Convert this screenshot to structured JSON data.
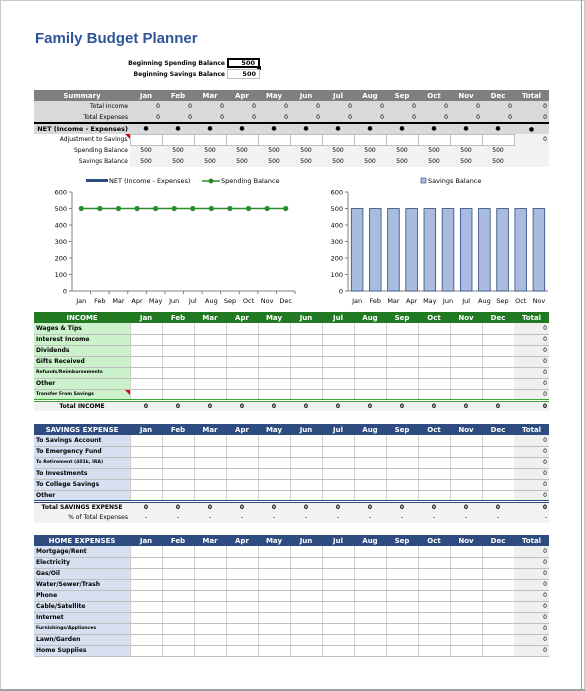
{
  "title": "Family Budget Planner",
  "beginning": {
    "spending_label": "Beginning Spending Balance",
    "spending_value": "500",
    "savings_label": "Beginning Savings Balance",
    "savings_value": "500"
  },
  "months": [
    "Jan",
    "Feb",
    "Mar",
    "Apr",
    "May",
    "Jun",
    "Jul",
    "Aug",
    "Sep",
    "Oct",
    "Nov",
    "Dec"
  ],
  "total_label": "Total",
  "summary": {
    "header": "Summary",
    "rows": [
      {
        "label": "Total Income",
        "values": [
          "0",
          "0",
          "0",
          "0",
          "0",
          "0",
          "0",
          "0",
          "0",
          "0",
          "0",
          "0"
        ],
        "total": "0"
      },
      {
        "label": "Total Expenses",
        "values": [
          "0",
          "0",
          "0",
          "0",
          "0",
          "0",
          "0",
          "0",
          "0",
          "0",
          "0",
          "0"
        ],
        "total": "0"
      },
      {
        "label": "NET (Income - Expenses)",
        "values": [
          "●",
          "●",
          "●",
          "●",
          "●",
          "●",
          "●",
          "●",
          "●",
          "●",
          "●",
          "●"
        ],
        "total": "●"
      },
      {
        "label": "Adjustment to Savings",
        "values": [
          "",
          "",
          "",
          "",
          "",
          "",
          "",
          "",
          "",
          "",
          "",
          ""
        ],
        "total": "0"
      },
      {
        "label": "Spending Balance",
        "values": [
          "500",
          "500",
          "500",
          "500",
          "500",
          "500",
          "500",
          "500",
          "500",
          "500",
          "500",
          "500"
        ],
        "total": ""
      },
      {
        "label": "Savings Balance",
        "values": [
          "500",
          "500",
          "500",
          "500",
          "500",
          "500",
          "500",
          "500",
          "500",
          "500",
          "500",
          "500"
        ],
        "total": ""
      }
    ]
  },
  "chart_data": [
    {
      "type": "line",
      "title": "",
      "legend": [
        "NET (Income - Expenses)",
        "Spending Balance"
      ],
      "legend_position": "top",
      "categories": [
        "Jan",
        "Feb",
        "Mar",
        "Apr",
        "May",
        "Jun",
        "Jul",
        "Aug",
        "Sep",
        "Oct",
        "Nov",
        "Dec"
      ],
      "series": [
        {
          "name": "NET (Income - Expenses)",
          "kind": "bar",
          "values": [
            0,
            0,
            0,
            0,
            0,
            0,
            0,
            0,
            0,
            0,
            0,
            0
          ],
          "color": "#2e4c80"
        },
        {
          "name": "Spending Balance",
          "kind": "line",
          "values": [
            500,
            500,
            500,
            500,
            500,
            500,
            500,
            500,
            500,
            500,
            500,
            500
          ],
          "color": "#2e8b2e"
        }
      ],
      "yticks": [
        "0",
        "100",
        "200",
        "300",
        "400",
        "500",
        "600"
      ],
      "ylim": [
        0,
        600
      ],
      "grid": false
    },
    {
      "type": "bar",
      "title": "",
      "legend": [
        "Savings Balance"
      ],
      "legend_position": "top",
      "categories": [
        "Jan",
        "Feb",
        "Mar",
        "Apr",
        "May",
        "Jun",
        "Jul",
        "Aug",
        "Sep",
        "Oct",
        "Nov"
      ],
      "series": [
        {
          "name": "Savings Balance",
          "values": [
            500,
            500,
            500,
            500,
            500,
            500,
            500,
            500,
            500,
            500,
            500
          ],
          "color": "#a9bce0"
        }
      ],
      "yticks": [
        "0",
        "100",
        "200",
        "300",
        "400",
        "500",
        "600"
      ],
      "ylim": [
        0,
        600
      ],
      "grid": false
    }
  ],
  "income": {
    "header": "INCOME",
    "rows": [
      "Wages & Tips",
      "Interest Income",
      "Dividends",
      "Gifts Received",
      "Refunds/Reimbursements",
      "Other",
      "Transfer From Savings"
    ],
    "row_total": "0",
    "total_label": "Total INCOME",
    "total_values": [
      "0",
      "0",
      "0",
      "0",
      "0",
      "0",
      "0",
      "0",
      "0",
      "0",
      "0",
      "0"
    ],
    "total_total": "0"
  },
  "savings": {
    "header": "SAVINGS EXPENSE",
    "rows": [
      "To Savings Account",
      "To Emergency Fund",
      "To Retirement (401k, IRA)",
      "To Investments",
      "To College Savings",
      "Other"
    ],
    "row_total": "0",
    "total_label": "Total SAVINGS EXPENSE",
    "total_values": [
      "0",
      "0",
      "0",
      "0",
      "0",
      "0",
      "0",
      "0",
      "0",
      "0",
      "0",
      "0"
    ],
    "total_total": "0",
    "pct_label": "% of Total Expenses",
    "pct_values": [
      "-",
      "-",
      "-",
      "-",
      "-",
      "-",
      "-",
      "-",
      "-",
      "-",
      "-",
      "-"
    ],
    "pct_total": "-"
  },
  "home": {
    "header": "HOME EXPENSES",
    "rows": [
      "Mortgage/Rent",
      "Electricity",
      "Gas/Oil",
      "Water/Sewer/Trash",
      "Phone",
      "Cable/Satellite",
      "Internet",
      "Furnishings/Appliances",
      "Lawn/Garden",
      "Home Supplies"
    ],
    "row_total": "0"
  }
}
